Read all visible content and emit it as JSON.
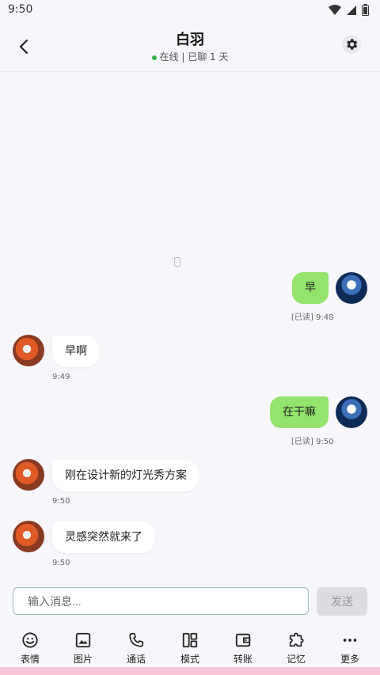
{
  "status": {
    "time": "9:50"
  },
  "header": {
    "title": "白羽",
    "subtitle": "在线 | 已聊 1 天"
  },
  "messages": [
    {
      "side": "out",
      "text": "早",
      "meta": "[已读] 9:48"
    },
    {
      "side": "in",
      "text": "早啊",
      "meta": "9:49"
    },
    {
      "side": "out",
      "text": "在干嘛",
      "meta": "[已读] 9:50"
    },
    {
      "side": "in",
      "text": "刚在设计新的灯光秀方案",
      "meta": "9:50"
    },
    {
      "side": "in",
      "text": "灵感突然就来了",
      "meta": "9:50"
    }
  ],
  "composer": {
    "placeholder": "输入消息...",
    "send_label": "发送"
  },
  "toolbar": {
    "items": [
      {
        "label": "表情",
        "icon": "smiley-icon"
      },
      {
        "label": "图片",
        "icon": "image-icon"
      },
      {
        "label": "通话",
        "icon": "phone-icon"
      },
      {
        "label": "模式",
        "icon": "layout-icon"
      },
      {
        "label": "转账",
        "icon": "wallet-icon"
      },
      {
        "label": "记忆",
        "icon": "puzzle-icon"
      },
      {
        "label": "更多",
        "icon": "more-icon"
      }
    ]
  },
  "colors": {
    "outgoing_bubble": "#93e36d",
    "online_dot": "#3bb54a"
  }
}
